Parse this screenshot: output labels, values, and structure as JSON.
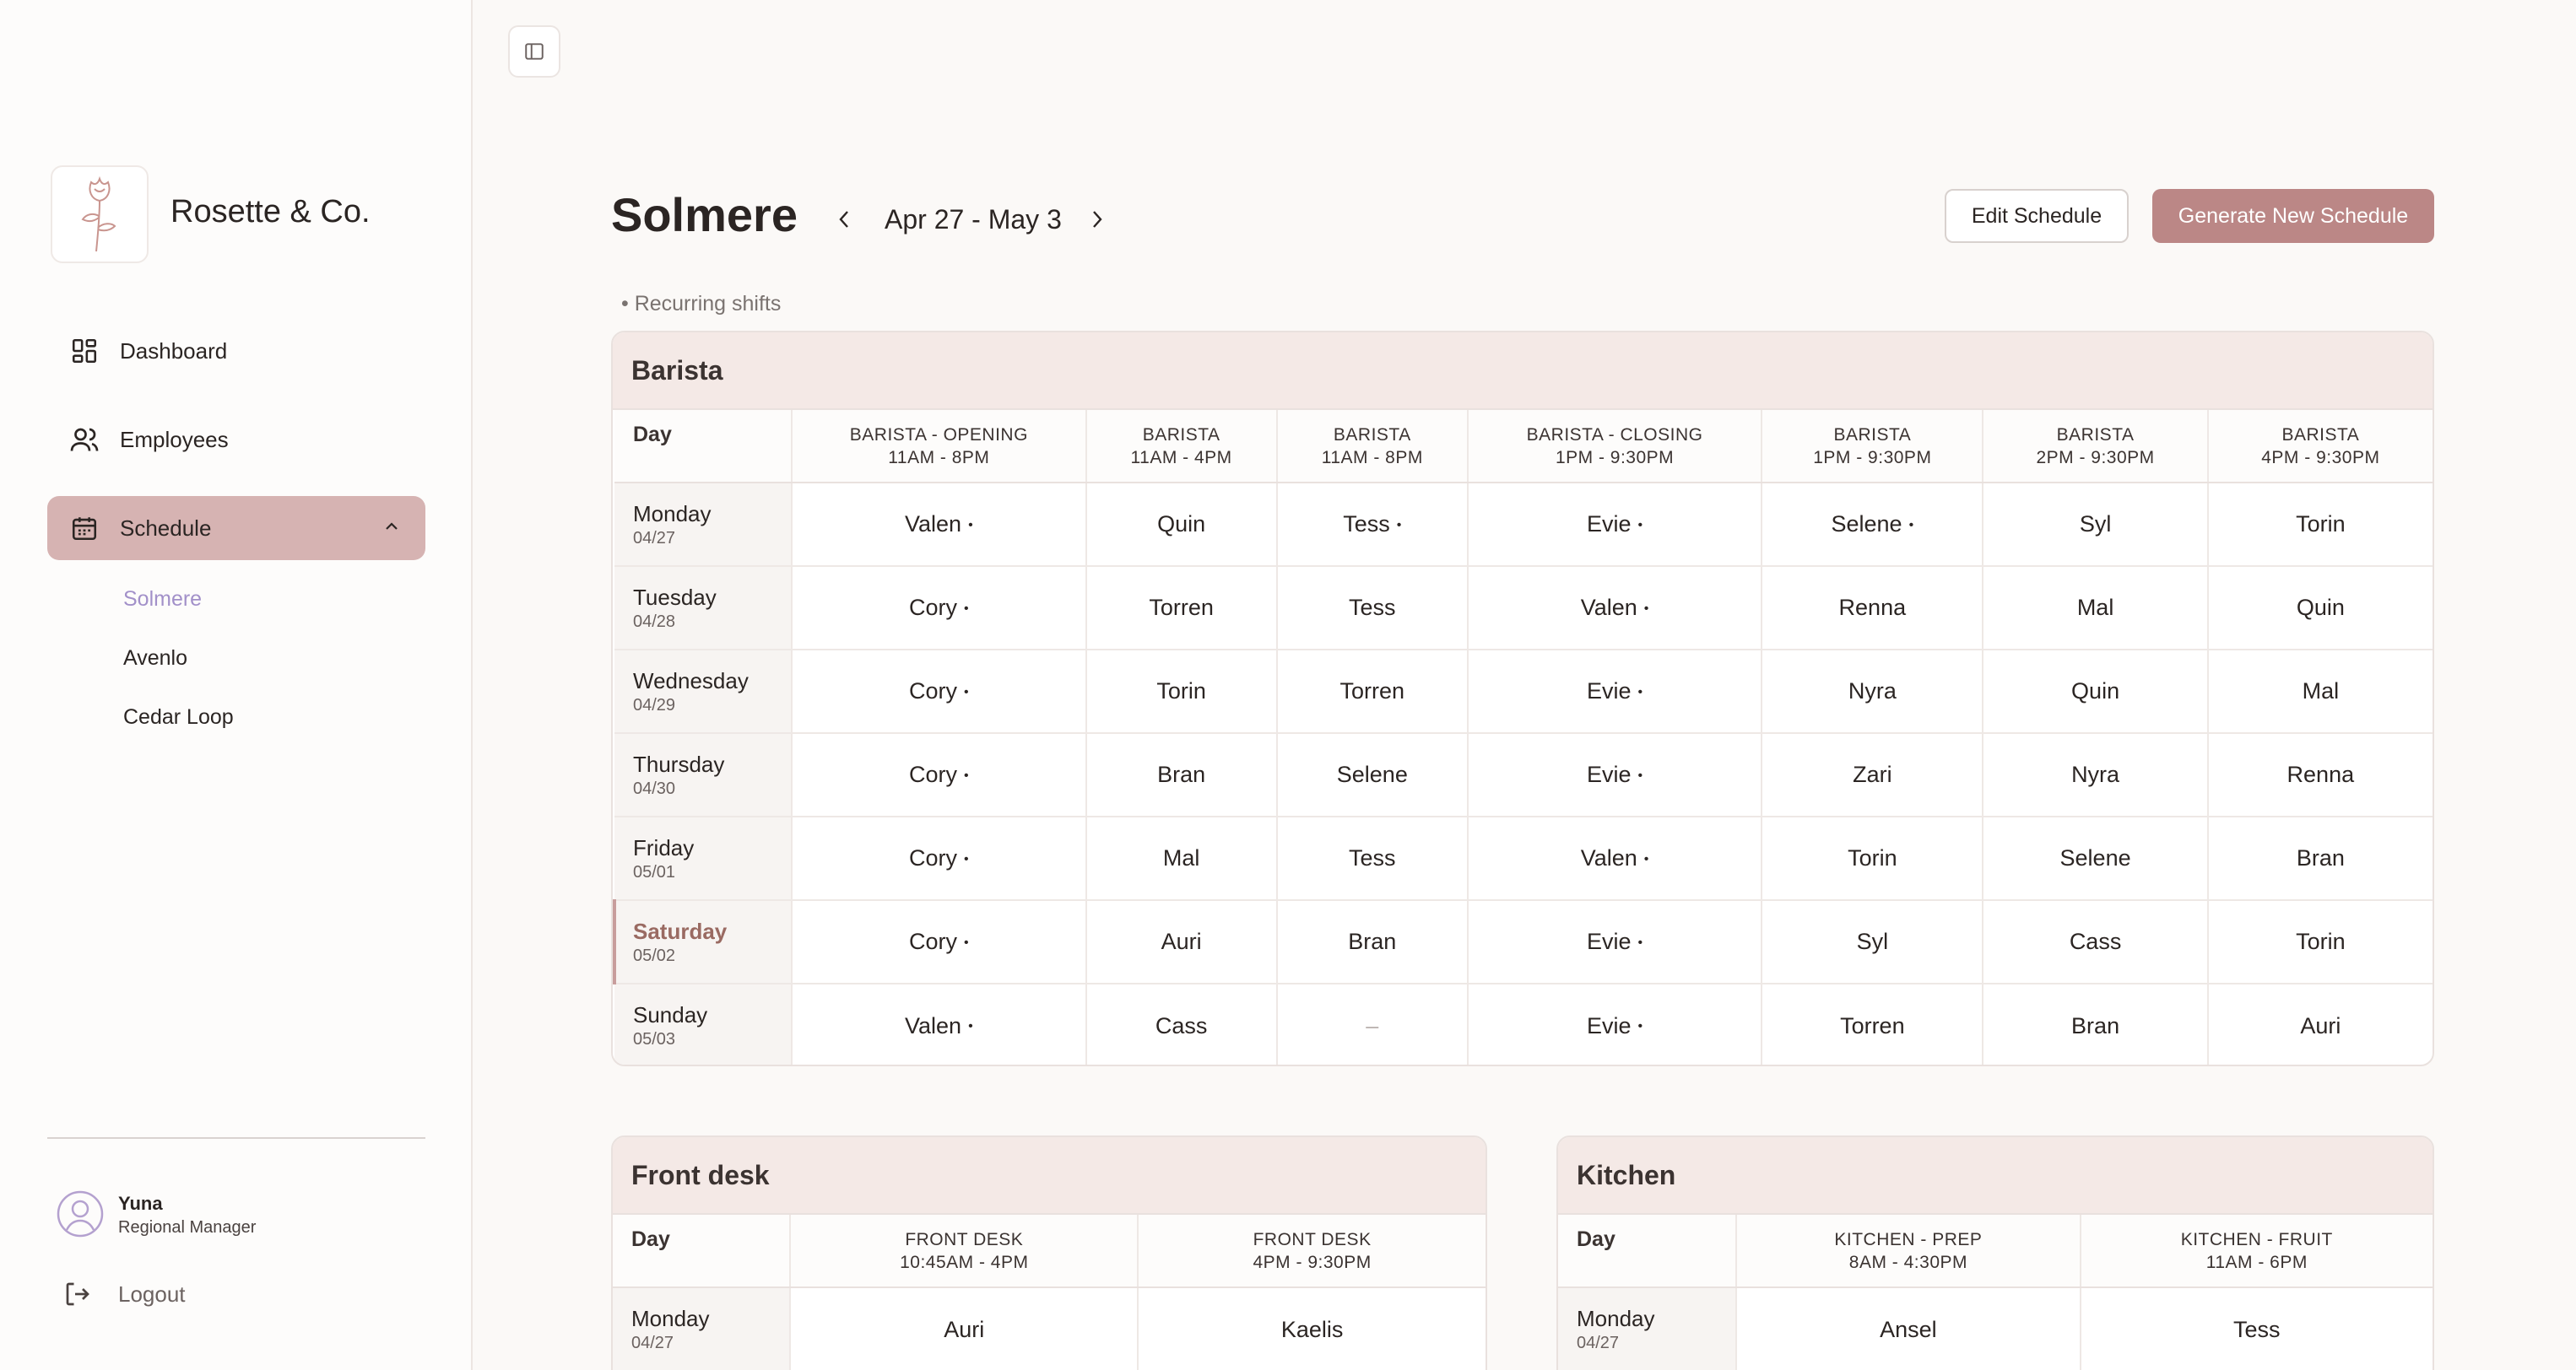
{
  "brand": "Rosette & Co.",
  "nav": {
    "dashboard": "Dashboard",
    "employees": "Employees",
    "schedule": "Schedule",
    "sub": [
      "Solmere",
      "Avenlo",
      "Cedar Loop"
    ]
  },
  "user": {
    "name": "Yuna",
    "role": "Regional Manager"
  },
  "logout": "Logout",
  "header": {
    "title": "Solmere",
    "date_range": "Apr 27 - May 3",
    "edit_label": "Edit Schedule",
    "generate_label": "Generate New Schedule",
    "legend": "• Recurring shifts"
  },
  "colors": {
    "accent": "#bb8786",
    "active_nav": "#d6b3b2",
    "sub_active": "#a290c9"
  },
  "barista": {
    "title": "Barista",
    "day_header": "Day",
    "columns": [
      {
        "role": "BARISTA - OPENING",
        "time": "11AM - 8PM"
      },
      {
        "role": "BARISTA",
        "time": "11AM - 4PM"
      },
      {
        "role": "BARISTA",
        "time": "11AM - 8PM"
      },
      {
        "role": "BARISTA - CLOSING",
        "time": "1PM - 9:30PM"
      },
      {
        "role": "BARISTA",
        "time": "1PM - 9:30PM"
      },
      {
        "role": "BARISTA",
        "time": "2PM - 9:30PM"
      },
      {
        "role": "BARISTA",
        "time": "4PM - 9:30PM"
      }
    ],
    "rows": [
      {
        "day": "Monday",
        "date": "04/27",
        "cells": [
          [
            "Valen",
            true
          ],
          [
            "Quin",
            false
          ],
          [
            "Tess",
            true
          ],
          [
            "Evie",
            true
          ],
          [
            "Selene",
            true
          ],
          [
            "Syl",
            false
          ],
          [
            "Torin",
            false
          ]
        ]
      },
      {
        "day": "Tuesday",
        "date": "04/28",
        "cells": [
          [
            "Cory",
            true
          ],
          [
            "Torren",
            false
          ],
          [
            "Tess",
            false
          ],
          [
            "Valen",
            true
          ],
          [
            "Renna",
            false
          ],
          [
            "Mal",
            false
          ],
          [
            "Quin",
            false
          ]
        ]
      },
      {
        "day": "Wednesday",
        "date": "04/29",
        "cells": [
          [
            "Cory",
            true
          ],
          [
            "Torin",
            false
          ],
          [
            "Torren",
            false
          ],
          [
            "Evie",
            true
          ],
          [
            "Nyra",
            false
          ],
          [
            "Quin",
            false
          ],
          [
            "Mal",
            false
          ]
        ]
      },
      {
        "day": "Thursday",
        "date": "04/30",
        "cells": [
          [
            "Cory",
            true
          ],
          [
            "Bran",
            false
          ],
          [
            "Selene",
            false
          ],
          [
            "Evie",
            true
          ],
          [
            "Zari",
            false
          ],
          [
            "Nyra",
            false
          ],
          [
            "Renna",
            false
          ]
        ]
      },
      {
        "day": "Friday",
        "date": "05/01",
        "cells": [
          [
            "Cory",
            true
          ],
          [
            "Mal",
            false
          ],
          [
            "Tess",
            false
          ],
          [
            "Valen",
            true
          ],
          [
            "Torin",
            false
          ],
          [
            "Selene",
            false
          ],
          [
            "Bran",
            false
          ]
        ]
      },
      {
        "day": "Saturday",
        "date": "05/02",
        "today": true,
        "cells": [
          [
            "Cory",
            true
          ],
          [
            "Auri",
            false
          ],
          [
            "Bran",
            false
          ],
          [
            "Evie",
            true
          ],
          [
            "Syl",
            false
          ],
          [
            "Cass",
            false
          ],
          [
            "Torin",
            false
          ]
        ]
      },
      {
        "day": "Sunday",
        "date": "05/03",
        "cells": [
          [
            "Valen",
            true
          ],
          [
            "Cass",
            false
          ],
          [
            "–",
            false
          ],
          [
            "Evie",
            true
          ],
          [
            "Torren",
            false
          ],
          [
            "Bran",
            false
          ],
          [
            "Auri",
            false
          ]
        ]
      }
    ]
  },
  "front_desk": {
    "title": "Front desk",
    "day_header": "Day",
    "columns": [
      {
        "role": "FRONT DESK",
        "time": "10:45AM - 4PM"
      },
      {
        "role": "FRONT DESK",
        "time": "4PM - 9:30PM"
      }
    ],
    "rows": [
      {
        "day": "Monday",
        "date": "04/27",
        "cells": [
          [
            "Auri",
            false
          ],
          [
            "Kaelis",
            false
          ]
        ]
      }
    ]
  },
  "kitchen": {
    "title": "Kitchen",
    "day_header": "Day",
    "columns": [
      {
        "role": "KITCHEN - PREP",
        "time": "8AM - 4:30PM"
      },
      {
        "role": "KITCHEN - FRUIT",
        "time": "11AM - 6PM"
      }
    ],
    "rows": [
      {
        "day": "Monday",
        "date": "04/27",
        "cells": [
          [
            "Ansel",
            false
          ],
          [
            "Tess",
            false
          ]
        ]
      }
    ]
  }
}
